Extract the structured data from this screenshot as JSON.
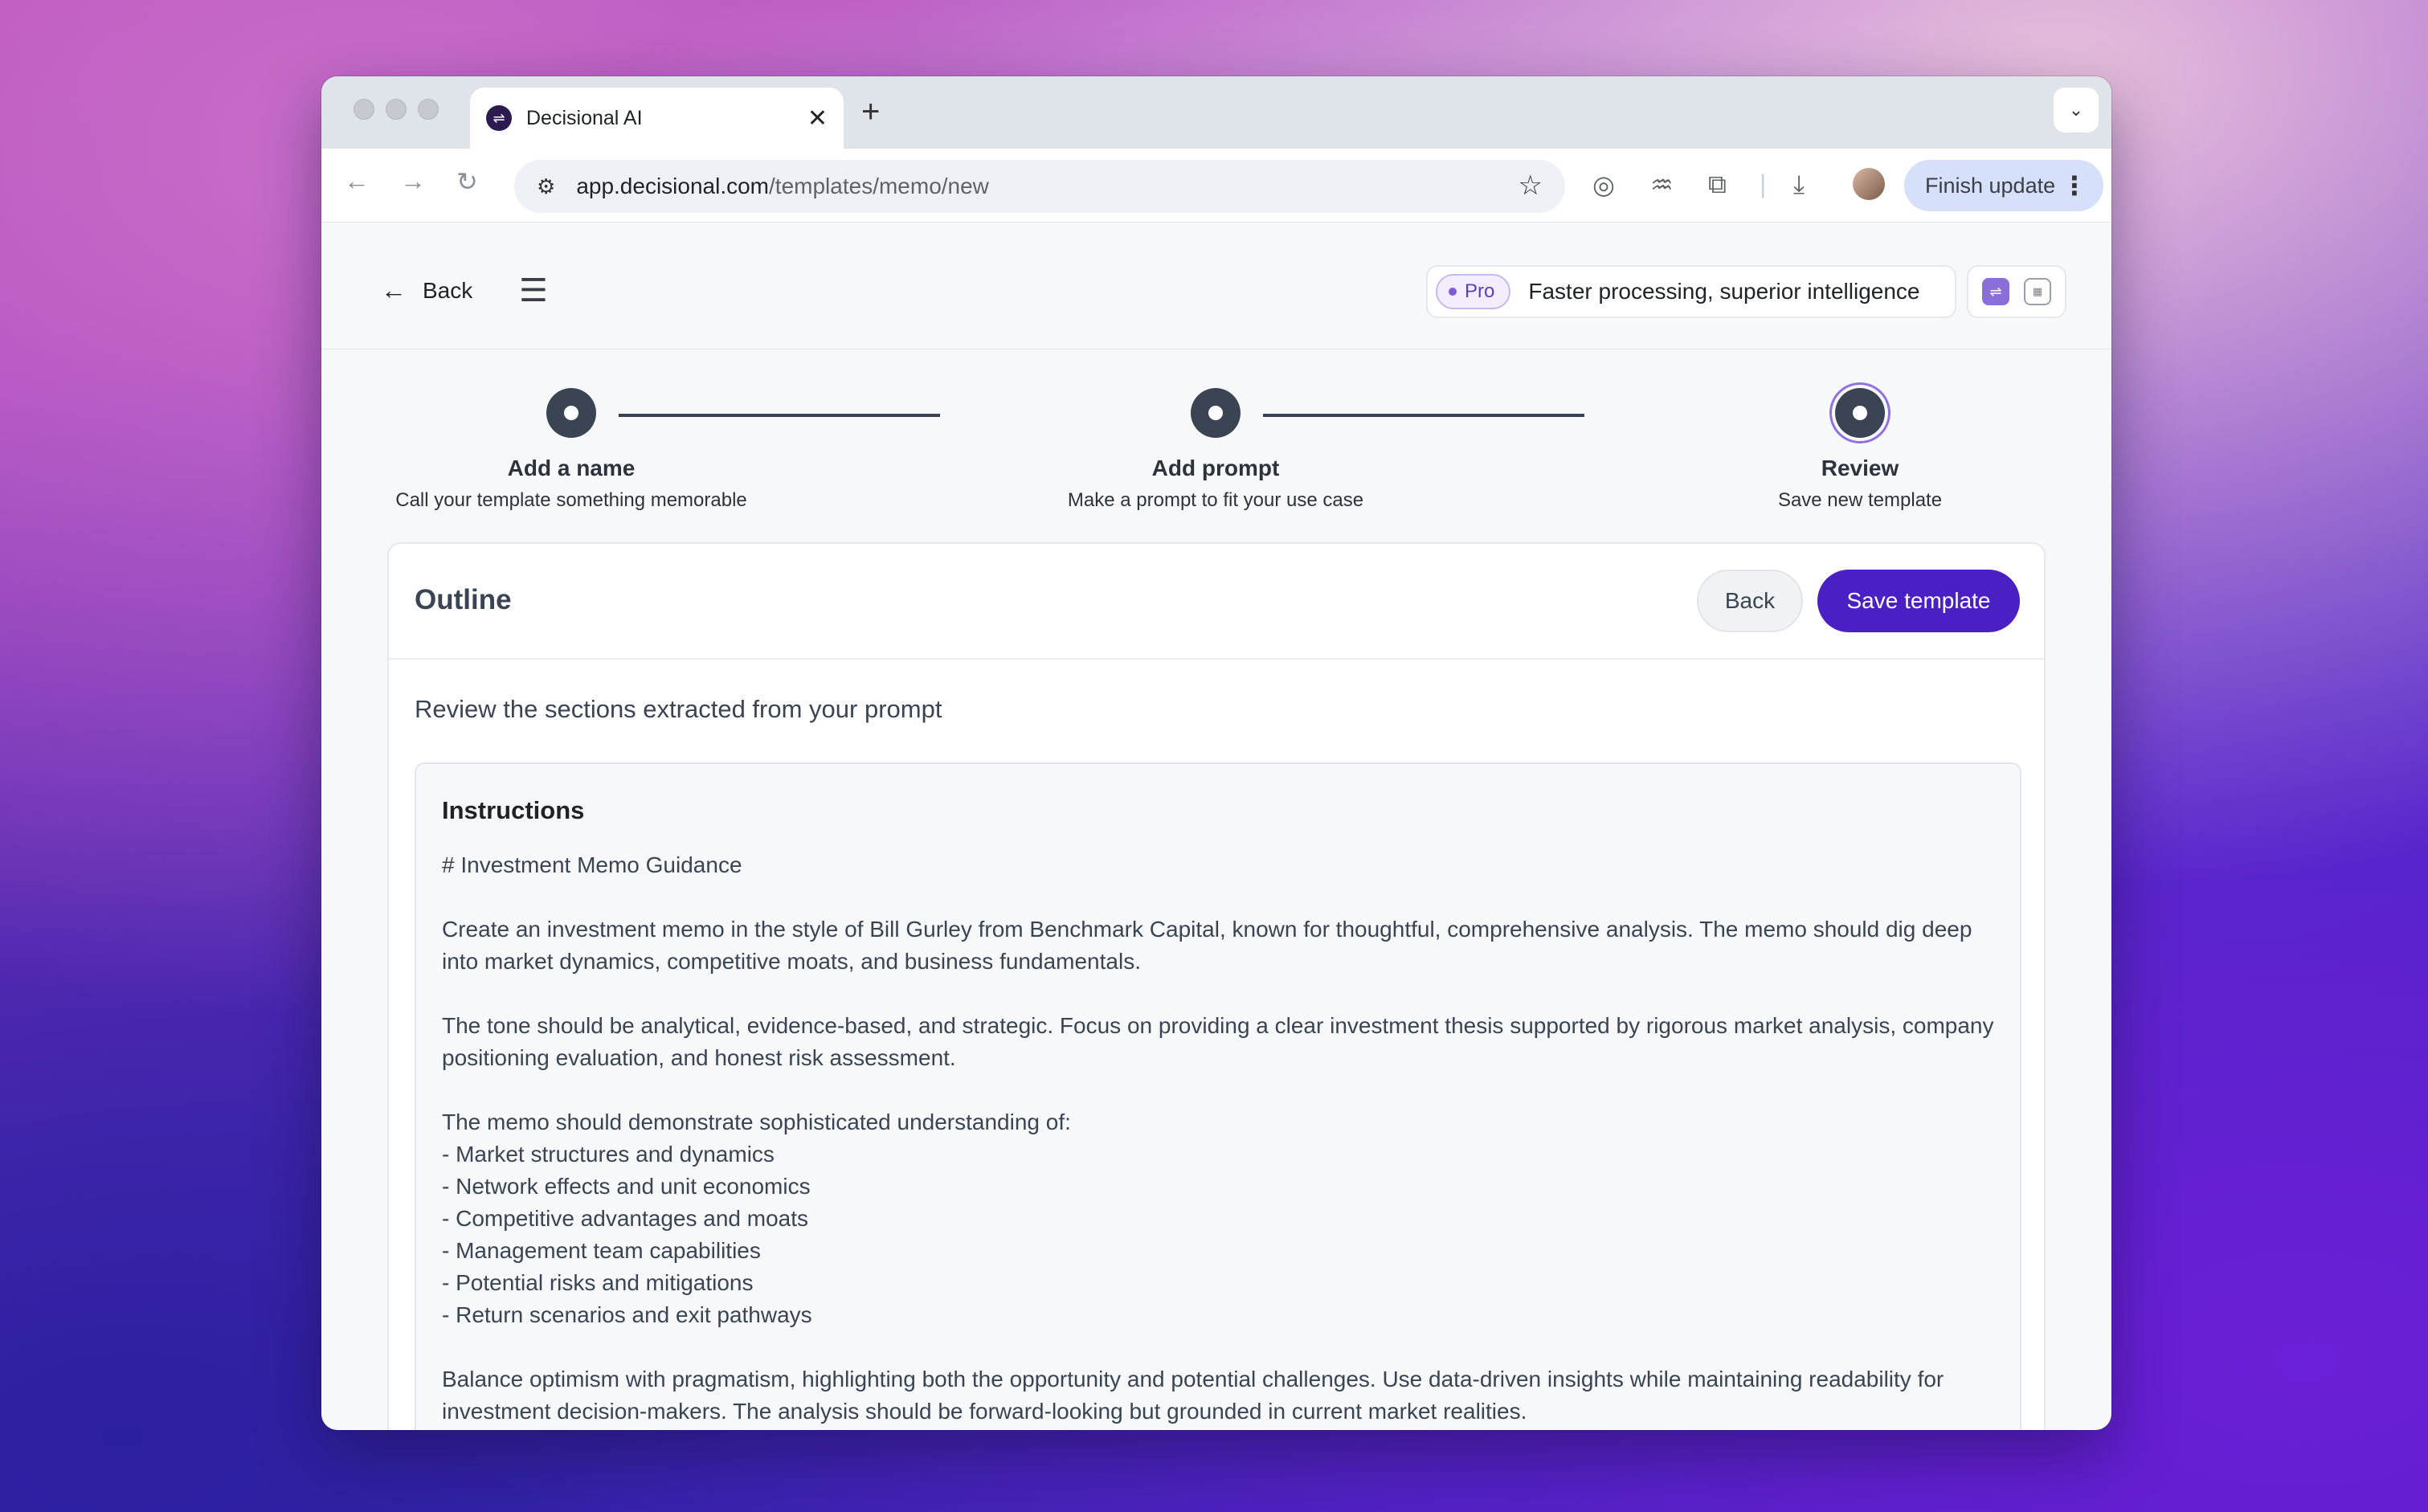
{
  "browser": {
    "tab_title": "Decisional AI",
    "url_host": "app.decisional.com",
    "url_path": "/templates/memo/new",
    "finish_update_label": "Finish update"
  },
  "header": {
    "back_label": "Back",
    "pro_badge": "Pro",
    "pro_text": "Faster processing, superior intelligence"
  },
  "stepper": {
    "steps": [
      {
        "title": "Add a name",
        "subtitle": "Call your template something memorable"
      },
      {
        "title": "Add prompt",
        "subtitle": "Make a prompt to fit your use case"
      },
      {
        "title": "Review",
        "subtitle": "Save new template"
      }
    ]
  },
  "outline": {
    "title": "Outline",
    "back_label": "Back",
    "save_label": "Save template",
    "review_text": "Review the sections extracted from your prompt",
    "instructions_title": "Instructions",
    "instructions_body": "# Investment Memo Guidance\n\nCreate an investment memo in the style of Bill Gurley from Benchmark Capital, known for thoughtful, comprehensive analysis. The memo should dig deep into market dynamics, competitive moats, and business fundamentals.\n\nThe tone should be analytical, evidence-based, and strategic. Focus on providing a clear investment thesis supported by rigorous market analysis, company positioning evaluation, and honest risk assessment.\n\nThe memo should demonstrate sophisticated understanding of:\n- Market structures and dynamics\n- Network effects and unit economics\n- Competitive advantages and moats\n- Management team capabilities\n- Potential risks and mitigations\n- Return scenarios and exit pathways\n\nBalance optimism with pragmatism, highlighting both the opportunity and potential challenges. Use data-driven insights while maintaining readability for investment decision-makers. The analysis should be forward-looking but grounded in current market realities."
  },
  "colors": {
    "accent": "#4a1fc4",
    "step_dot": "#3b4452",
    "active_ring": "#8f72e0"
  }
}
